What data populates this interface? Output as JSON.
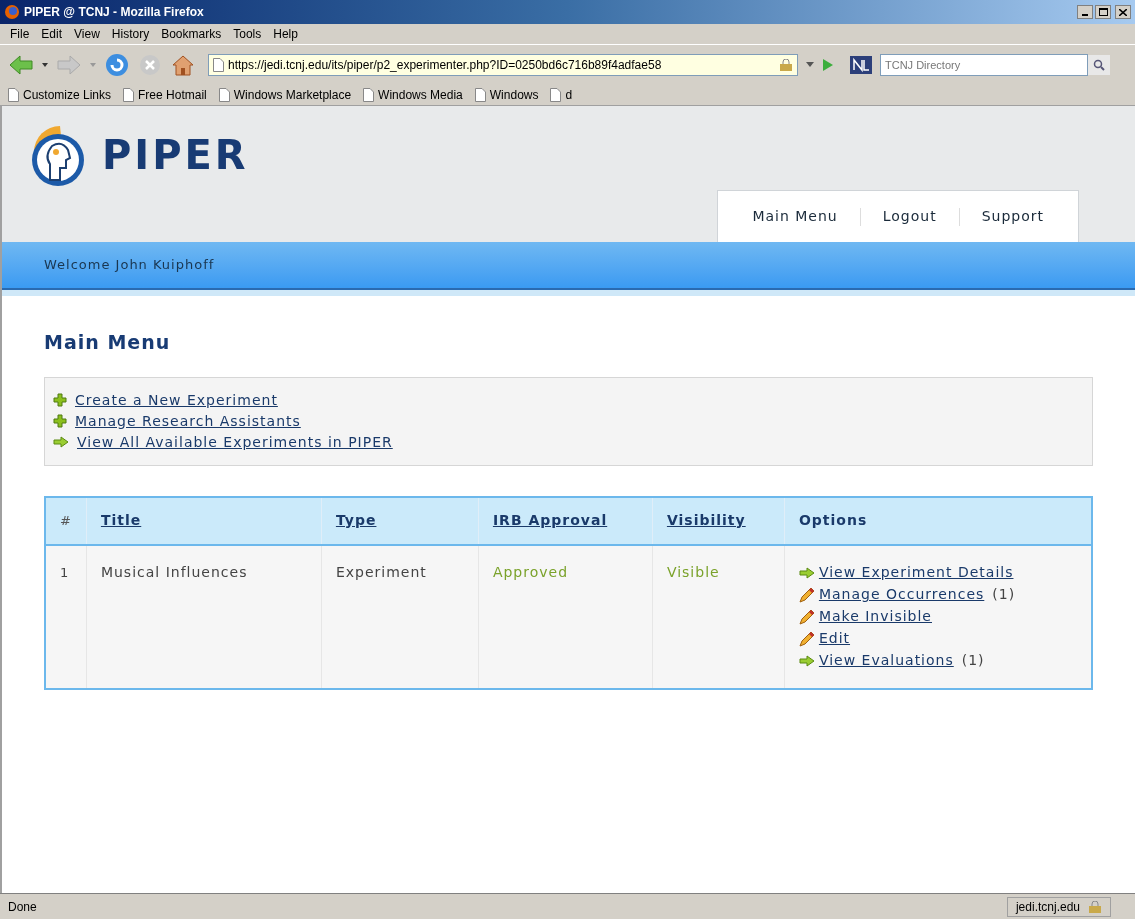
{
  "window": {
    "title": "PIPER @ TCNJ - Mozilla Firefox"
  },
  "menu": [
    "File",
    "Edit",
    "View",
    "History",
    "Bookmarks",
    "Tools",
    "Help"
  ],
  "address": {
    "value": "https://jedi.tcnj.edu/its/piper/p2_experimenter.php?ID=0250bd6c716b89f4adfae58"
  },
  "search": {
    "placeholder": "TCNJ Directory"
  },
  "bookmarks": [
    "Customize Links",
    "Free Hotmail",
    "Windows Marketplace",
    "Windows Media",
    "Windows",
    "d"
  ],
  "site": {
    "logo": "PIPER",
    "nav": [
      "Main Menu",
      "Logout",
      "Support"
    ],
    "welcome": "Welcome John Kuiphoff"
  },
  "heading": "Main Menu",
  "actions": [
    {
      "kind": "plus",
      "label": "Create a New Experiment"
    },
    {
      "kind": "plus",
      "label": "Manage Research Assistants"
    },
    {
      "kind": "arrow",
      "label": "View All Available Experiments in PIPER"
    }
  ],
  "table": {
    "columns": [
      {
        "label": "#",
        "link": false
      },
      {
        "label": "Title",
        "link": true
      },
      {
        "label": "Type",
        "link": true
      },
      {
        "label": "IRB Approval",
        "link": true
      },
      {
        "label": "Visibility",
        "link": true
      },
      {
        "label": "Options",
        "link": false
      }
    ],
    "rows": [
      {
        "number": "1",
        "title": "Musical Influences",
        "type": "Experiment",
        "irb": "Approved",
        "visibility": "Visible",
        "options": [
          {
            "kind": "arrow",
            "label": "View Experiment Details"
          },
          {
            "kind": "pencil",
            "label": "Manage Occurrences",
            "count": "(1)"
          },
          {
            "kind": "pencil",
            "label": "Make Invisible"
          },
          {
            "kind": "pencil",
            "label": "Edit"
          },
          {
            "kind": "arrow",
            "label": "View Evaluations",
            "count": "(1)"
          }
        ]
      }
    ]
  },
  "status_bar": {
    "text": "Done",
    "host": "jedi.tcnj.edu"
  }
}
